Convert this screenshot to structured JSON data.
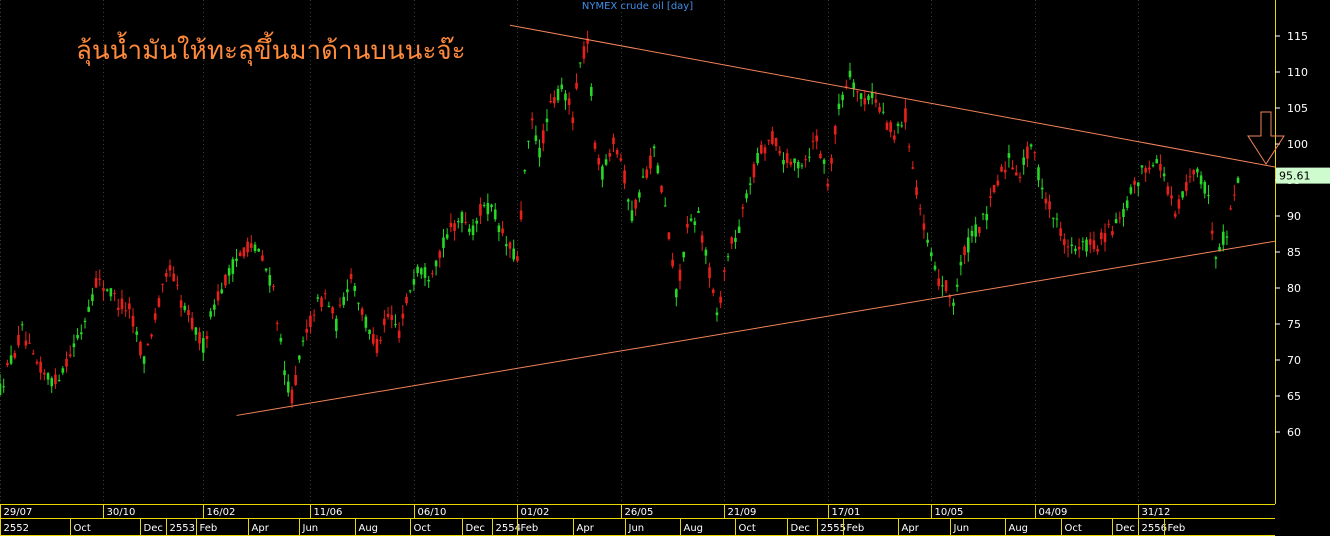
{
  "chart": {
    "title": "NYMEX crude oil [day]",
    "annotation": "ลุ้นน้ำมันให้ทะลุขึ้นมาด้านบนนะจ๊ะ",
    "last_price": "95.61"
  },
  "chart_data": {
    "type": "candlestick",
    "title": "NYMEX crude oil [day]",
    "ylim": [
      50,
      120
    ],
    "y_ticks": [
      60,
      65,
      70,
      75,
      80,
      85,
      90,
      95,
      100,
      105,
      110,
      115
    ],
    "x_range_index": [
      0,
      345
    ],
    "x_top_labels": [
      {
        "i": 0,
        "label": "29/07"
      },
      {
        "i": 28,
        "label": "30/10"
      },
      {
        "i": 55,
        "label": "16/02"
      },
      {
        "i": 84,
        "label": "11/06"
      },
      {
        "i": 112,
        "label": "06/10"
      },
      {
        "i": 140,
        "label": "01/02"
      },
      {
        "i": 168,
        "label": "26/05"
      },
      {
        "i": 196,
        "label": "21/09"
      },
      {
        "i": 224,
        "label": "17/01"
      },
      {
        "i": 252,
        "label": "10/05"
      },
      {
        "i": 280,
        "label": "04/09"
      },
      {
        "i": 308,
        "label": "31/12"
      }
    ],
    "x_bottom_labels": [
      {
        "i": 0,
        "label": "2552"
      },
      {
        "i": 19,
        "label": "Oct"
      },
      {
        "i": 38,
        "label": "Dec"
      },
      {
        "i": 45,
        "label": "2553"
      },
      {
        "i": 53,
        "label": "Feb"
      },
      {
        "i": 67,
        "label": "Apr"
      },
      {
        "i": 81,
        "label": "Jun"
      },
      {
        "i": 96,
        "label": "Aug"
      },
      {
        "i": 111,
        "label": "Oct"
      },
      {
        "i": 125,
        "label": "Dec"
      },
      {
        "i": 133,
        "label": "2554"
      },
      {
        "i": 140,
        "label": "Feb"
      },
      {
        "i": 155,
        "label": "Apr"
      },
      {
        "i": 169,
        "label": "Jun"
      },
      {
        "i": 184,
        "label": "Aug"
      },
      {
        "i": 199,
        "label": "Oct"
      },
      {
        "i": 213,
        "label": "Dec"
      },
      {
        "i": 221,
        "label": "2555"
      },
      {
        "i": 228,
        "label": "Feb"
      },
      {
        "i": 243,
        "label": "Apr"
      },
      {
        "i": 257,
        "label": "Jun"
      },
      {
        "i": 272,
        "label": "Aug"
      },
      {
        "i": 287,
        "label": "Oct"
      },
      {
        "i": 301,
        "label": "Dec"
      },
      {
        "i": 308,
        "label": "2556"
      },
      {
        "i": 315,
        "label": "Feb"
      }
    ],
    "price_path": [
      [
        0,
        66
      ],
      [
        3,
        70
      ],
      [
        6,
        74
      ],
      [
        9,
        70
      ],
      [
        12,
        68
      ],
      [
        15,
        67
      ],
      [
        18,
        70
      ],
      [
        22,
        74
      ],
      [
        26,
        81
      ],
      [
        29,
        80
      ],
      [
        32,
        78
      ],
      [
        35,
        77
      ],
      [
        39,
        70
      ],
      [
        42,
        76
      ],
      [
        46,
        83
      ],
      [
        49,
        78
      ],
      [
        52,
        75
      ],
      [
        55,
        72
      ],
      [
        58,
        78
      ],
      [
        61,
        81
      ],
      [
        64,
        84
      ],
      [
        67,
        86
      ],
      [
        70,
        85
      ],
      [
        74,
        80
      ],
      [
        77,
        68
      ],
      [
        79,
        65
      ],
      [
        82,
        72
      ],
      [
        85,
        77
      ],
      [
        88,
        79
      ],
      [
        91,
        75
      ],
      [
        95,
        82
      ],
      [
        99,
        75
      ],
      [
        102,
        72
      ],
      [
        105,
        76
      ],
      [
        108,
        74
      ],
      [
        111,
        80
      ],
      [
        113,
        83
      ],
      [
        116,
        82
      ],
      [
        119,
        85
      ],
      [
        122,
        88
      ],
      [
        125,
        90
      ],
      [
        128,
        88
      ],
      [
        131,
        92
      ],
      [
        134,
        90
      ],
      [
        137,
        86
      ],
      [
        140,
        84
      ],
      [
        142,
        96
      ],
      [
        144,
        103
      ],
      [
        146,
        99
      ],
      [
        149,
        105
      ],
      [
        152,
        108
      ],
      [
        155,
        104
      ],
      [
        157,
        111
      ],
      [
        159,
        114
      ],
      [
        161,
        100
      ],
      [
        163,
        96
      ],
      [
        166,
        101
      ],
      [
        168,
        98
      ],
      [
        171,
        90
      ],
      [
        174,
        95
      ],
      [
        177,
        99
      ],
      [
        180,
        91
      ],
      [
        183,
        79
      ],
      [
        186,
        88
      ],
      [
        189,
        90
      ],
      [
        192,
        82
      ],
      [
        194,
        76
      ],
      [
        197,
        85
      ],
      [
        200,
        88
      ],
      [
        203,
        95
      ],
      [
        206,
        99
      ],
      [
        209,
        101
      ],
      [
        212,
        98
      ],
      [
        215,
        97
      ],
      [
        218,
        98
      ],
      [
        221,
        101
      ],
      [
        224,
        95
      ],
      [
        227,
        105
      ],
      [
        230,
        110
      ],
      [
        233,
        106
      ],
      [
        236,
        107
      ],
      [
        239,
        104
      ],
      [
        242,
        101
      ],
      [
        245,
        104
      ],
      [
        247,
        97
      ],
      [
        250,
        88
      ],
      [
        253,
        82
      ],
      [
        256,
        80
      ],
      [
        258,
        78
      ],
      [
        261,
        85
      ],
      [
        264,
        88
      ],
      [
        267,
        90
      ],
      [
        270,
        95
      ],
      [
        273,
        98
      ],
      [
        276,
        96
      ],
      [
        279,
        100
      ],
      [
        282,
        94
      ],
      [
        285,
        90
      ],
      [
        288,
        87
      ],
      [
        291,
        85
      ],
      [
        294,
        86
      ],
      [
        297,
        86
      ],
      [
        300,
        88
      ],
      [
        303,
        89
      ],
      [
        306,
        93
      ],
      [
        309,
        96
      ],
      [
        312,
        98
      ],
      [
        315,
        96
      ],
      [
        318,
        90
      ],
      [
        321,
        94
      ],
      [
        324,
        97
      ],
      [
        327,
        92
      ],
      [
        329,
        85
      ],
      [
        332,
        88
      ],
      [
        335,
        95.61
      ]
    ],
    "trendlines": [
      {
        "from": [
          138,
          116.5
        ],
        "to": [
          345,
          96.8
        ]
      },
      {
        "from": [
          64,
          62.3
        ],
        "to": [
          345,
          86.5
        ]
      }
    ],
    "colors": {
      "background": "#000000",
      "up": "#27d827",
      "down": "#e8201b",
      "trendline": "#f2845a",
      "axis": "#e6d800",
      "text": "#ffffff",
      "price_label_bg": "#cffccf",
      "annotation": "#ff8a3c",
      "title": "#3f8fe8"
    }
  }
}
